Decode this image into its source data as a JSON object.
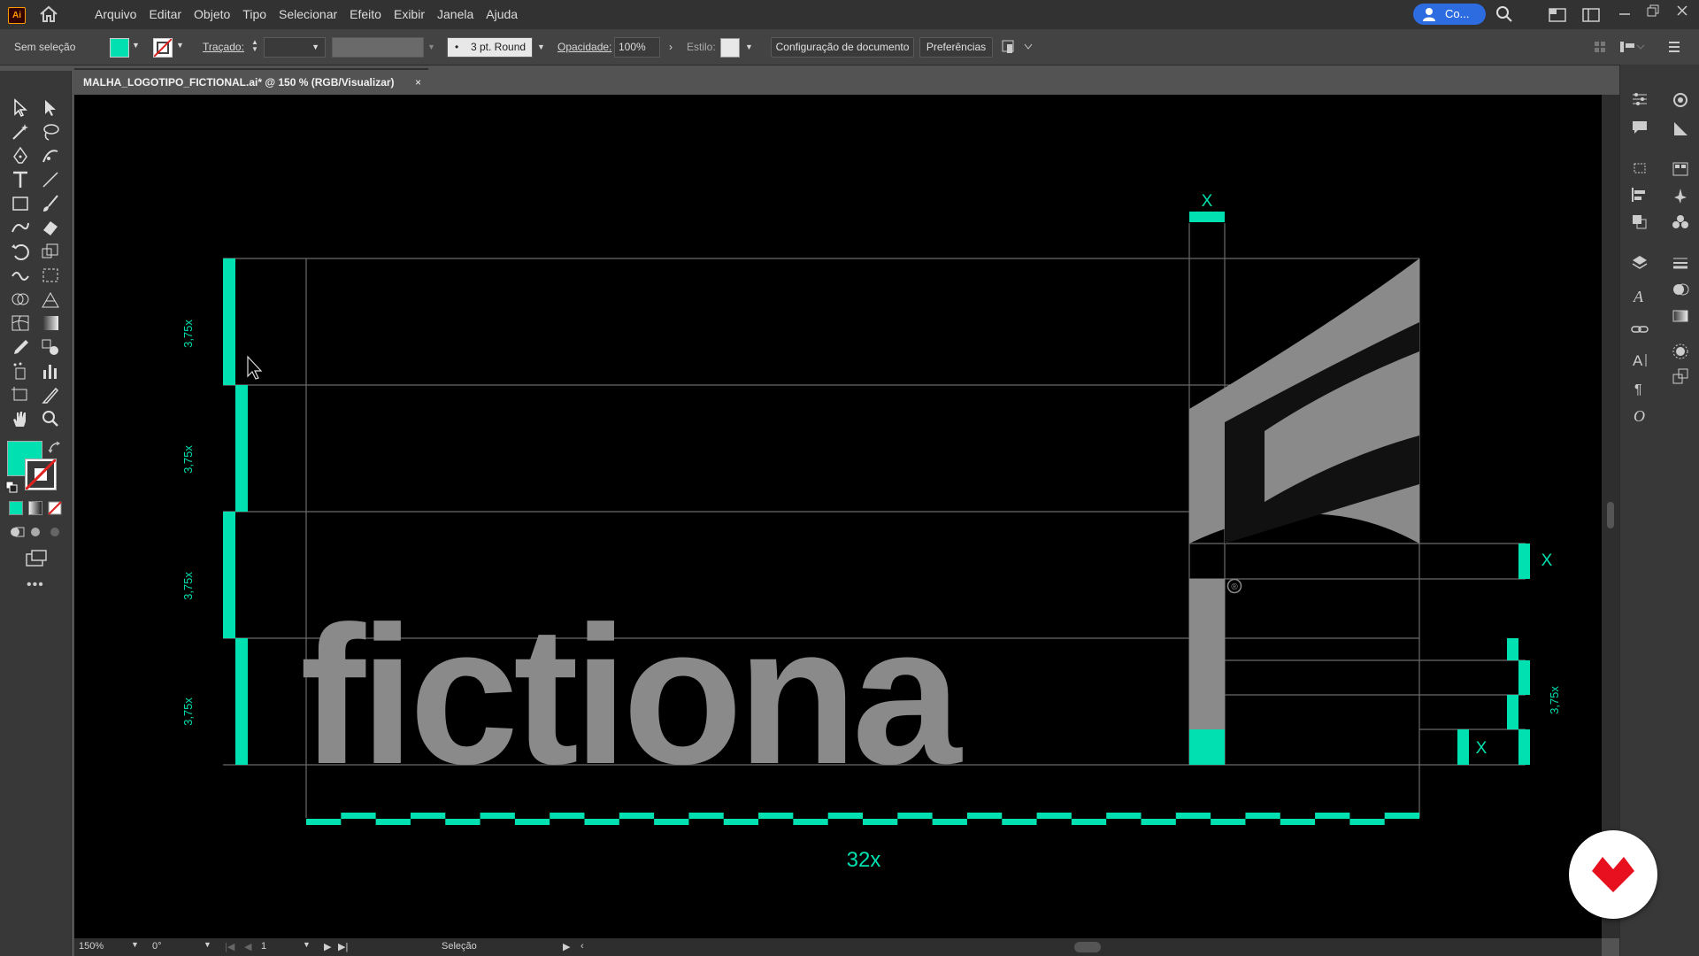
{
  "app": {
    "logo": "Ai"
  },
  "menu": [
    "Arquivo",
    "Editar",
    "Objeto",
    "Tipo",
    "Selecionar",
    "Efeito",
    "Exibir",
    "Janela",
    "Ajuda"
  ],
  "share_label": "Co...",
  "control": {
    "selection": "Sem seleção",
    "stroke_label": "Traçado:",
    "brush": "3 pt. Round",
    "opacity_label": "Opacidade:",
    "opacity_value": "100%",
    "style_label": "Estilo:",
    "doc_setup": "Configuração de documento",
    "preferences": "Preferências"
  },
  "colors": {
    "accent": "#00e0b0",
    "logo_gray": "#8a8a8a",
    "fill": "#00e0b0"
  },
  "document": {
    "tab_title": "MALHA_LOGOTIPO_FICTIONAL.ai* @ 150 % (RGB/Visualizar)",
    "close": "×"
  },
  "artwork": {
    "wordmark": "fictiona",
    "registered": "®",
    "left_measures": [
      "3,75x",
      "3,75x",
      "3,75x",
      "3,75x"
    ],
    "right_measure": "3,75x",
    "x_marks": [
      "X",
      "X",
      "X"
    ],
    "width_label": "32x"
  },
  "status": {
    "zoom": "150%",
    "rotation": "0°",
    "artboard": "1",
    "tool": "Seleção"
  }
}
